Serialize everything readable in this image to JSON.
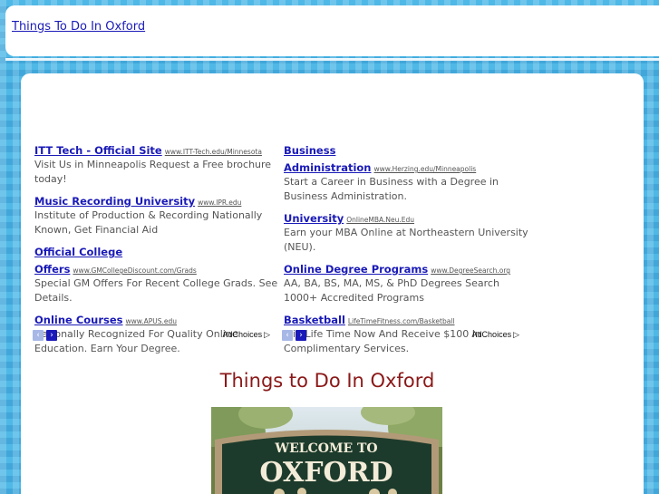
{
  "header": {
    "site_title": "Things To Do In Oxford"
  },
  "ads": {
    "left": [
      {
        "title": "ITT Tech - Official Site",
        "url": "www.ITT-Tech.edu/Minnesota",
        "desc": "Visit Us in Minneapolis Request a Free brochure today!"
      },
      {
        "title": "Music Recording University",
        "url": "www.IPR.edu",
        "desc": "Institute of Production & Recording Nationally Known, Get Financial Aid"
      },
      {
        "title": "Official College Offers",
        "url": "www.GMCollegeDiscount.com/Grads",
        "desc": "Special GM Offers For Recent College Grads. See Details."
      },
      {
        "title": "Online Courses",
        "url": "www.APUS.edu",
        "desc": "Nationally Recognized For Quality Online Education. Earn Your Degree."
      }
    ],
    "right": [
      {
        "title": "Business Administration",
        "url": "www.Herzing.edu/Minneapolis",
        "desc": "Start a Career in Business with a Degree in Business Administration."
      },
      {
        "title": "University",
        "url": "OnlineMBA.Neu.Edu",
        "desc": "Earn your MBA Online at Northeastern University (NEU)."
      },
      {
        "title": "Online Degree Programs",
        "url": "www.DegreeSearch.org",
        "desc": "AA, BA, BS, MA, MS, & PhD Degrees Search 1000+ Accredited Programs"
      },
      {
        "title": "Basketball",
        "url": "LifeTimeFitness.com/Basketball",
        "desc": "Join Life Time Now And Receive $100 In Complimentary Services."
      }
    ],
    "adchoices_label": "AdChoices",
    "prev_glyph": "‹",
    "next_glyph": "›",
    "adchoices_glyph": "▷"
  },
  "main": {
    "page_title": "Things to Do In Oxford",
    "sign_line1": "WELCOME TO",
    "sign_line2": "OXFORD"
  }
}
